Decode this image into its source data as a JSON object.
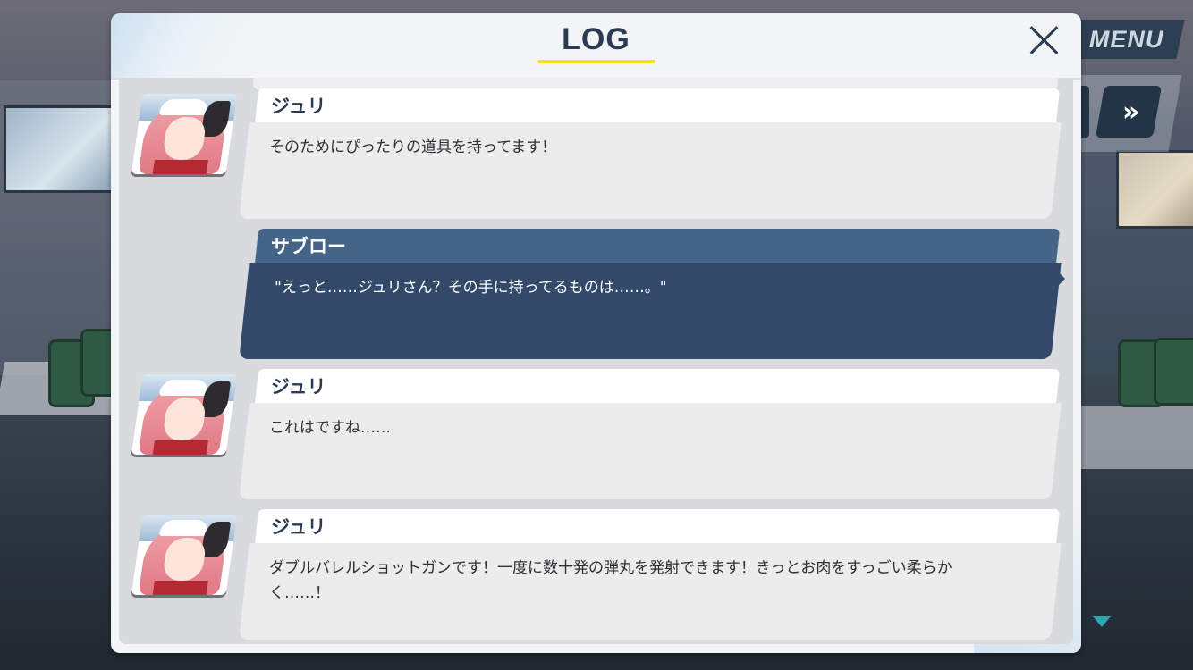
{
  "header": {
    "title": "LOG",
    "close_icon": "close-icon"
  },
  "controls": {
    "menu_label": "MENU",
    "fast_forward_label": "»"
  },
  "colors": {
    "title_underline": "#f3e11b",
    "player_bubble": "#33496a",
    "player_name_bar": "#446488",
    "scroll_arrow": "#2aa7b7"
  },
  "log": [
    {
      "speaker": "ジュリ",
      "text": "そのためにぴったりの道具を持ってます！",
      "has_avatar": true,
      "is_player": false
    },
    {
      "speaker": "サブロー",
      "text": "\"えっと……ジュリさん？その手に持ってるものは……。\"",
      "has_avatar": false,
      "is_player": true
    },
    {
      "speaker": "ジュリ",
      "text": "これはですね……",
      "has_avatar": true,
      "is_player": false
    },
    {
      "speaker": "ジュリ",
      "text": "ダブルバレルショットガンです！一度に数十発の弾丸を発射できます！きっとお肉をすっごい柔らかく……！",
      "has_avatar": true,
      "is_player": false
    }
  ]
}
